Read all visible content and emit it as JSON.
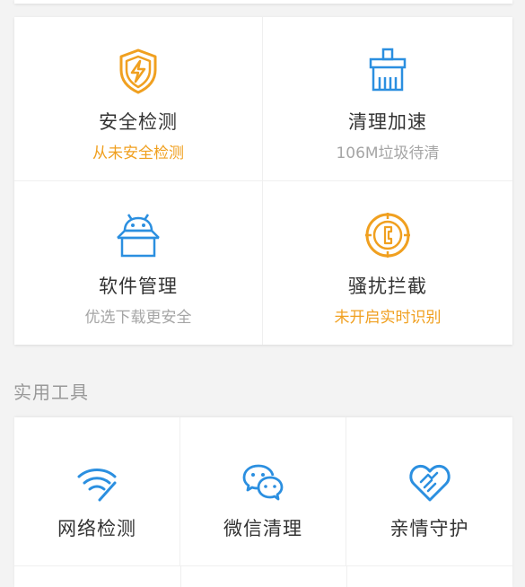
{
  "main_grid": [
    {
      "title": "安全检测",
      "subtitle": "从未安全检测",
      "icon": "shield-bolt-icon",
      "subtitle_state": "warning"
    },
    {
      "title": "清理加速",
      "subtitle": "106M垃圾待清",
      "icon": "broom-icon",
      "subtitle_state": "normal"
    },
    {
      "title": "软件管理",
      "subtitle": "优选下载更安全",
      "icon": "android-box-icon",
      "subtitle_state": "normal"
    },
    {
      "title": "骚扰拦截",
      "subtitle": "未开启实时识别",
      "icon": "phone-target-icon",
      "subtitle_state": "warning"
    }
  ],
  "tools_section": {
    "label": "实用工具",
    "items": [
      {
        "title": "网络检测",
        "icon": "wifi-icon"
      },
      {
        "title": "微信清理",
        "icon": "wechat-icon"
      },
      {
        "title": "亲情守护",
        "icon": "heart-hand-icon"
      }
    ]
  },
  "colors": {
    "orange": "#f0a020",
    "blue": "#2b8fe0",
    "text": "#333333",
    "muted": "#a5a5a5"
  }
}
